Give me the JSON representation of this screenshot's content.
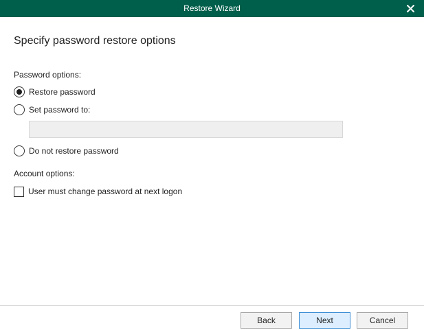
{
  "window": {
    "title": "Restore Wizard",
    "close_icon": "close-icon"
  },
  "page": {
    "heading": "Specify password restore options"
  },
  "password_options": {
    "label": "Password options:",
    "selected": "restore",
    "options": [
      {
        "id": "restore",
        "label": "Restore password"
      },
      {
        "id": "set",
        "label": "Set password to:"
      },
      {
        "id": "none",
        "label": "Do not restore password"
      }
    ],
    "password_value": ""
  },
  "account_options": {
    "label": "Account options:",
    "must_change_label": "User must change password at next logon",
    "must_change_checked": false
  },
  "footer": {
    "back_label": "Back",
    "next_label": "Next",
    "cancel_label": "Cancel"
  },
  "colors": {
    "titlebar": "#005f4b",
    "primary_button_bg": "#dceeff",
    "primary_button_border": "#3f8fd6"
  }
}
